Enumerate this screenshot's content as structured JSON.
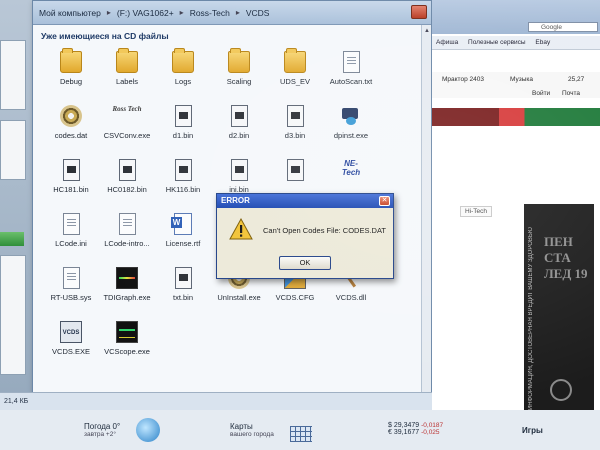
{
  "explorer": {
    "path": [
      "Мой компьютер",
      "(F:) VAG1062+",
      "Ross-Tech",
      "VCDS"
    ],
    "group_header": "Уже имеющиеся на CD файлы",
    "status_text": "21,4 КБ",
    "files": [
      {
        "label": "Debug",
        "icon": "folder-icon"
      },
      {
        "label": "Labels",
        "icon": "folder-icon"
      },
      {
        "label": "Logs",
        "icon": "folder-icon"
      },
      {
        "label": "Scaling",
        "icon": "folder-icon"
      },
      {
        "label": "UDS_EV",
        "icon": "folder-icon"
      },
      {
        "label": "AutoScan.txt",
        "icon": "text-file-icon"
      },
      {
        "label": "codes.dat",
        "icon": "cd-icon"
      },
      {
        "label": "CSVConv.exe",
        "icon": "rosstech-icon"
      },
      {
        "label": "d1.bin",
        "icon": "bin-file-icon"
      },
      {
        "label": "d2.bin",
        "icon": "bin-file-icon"
      },
      {
        "label": "d3.bin",
        "icon": "bin-file-icon"
      },
      {
        "label": "dpinst.exe",
        "icon": "installer-icon"
      },
      {
        "label": "HC181.bin",
        "icon": "bin-file-icon"
      },
      {
        "label": "HC0182.bin",
        "icon": "bin-file-icon"
      },
      {
        "label": "HK116.bin",
        "icon": "bin-file-icon"
      },
      {
        "label": "ini.bin",
        "icon": "bin-file-icon"
      },
      {
        "label": "",
        "icon": "bin-file-icon"
      },
      {
        "label": "",
        "icon": "nettech-icon"
      },
      {
        "label": "LCode.ini",
        "icon": "text-file-icon"
      },
      {
        "label": "LCode-intro...",
        "icon": "text-file-icon"
      },
      {
        "label": "License.rtf",
        "icon": "word-icon"
      },
      {
        "label": "RT-USB.sys",
        "icon": "text-file-icon"
      },
      {
        "label": "TDIGraph.exe",
        "icon": "chart-icon"
      },
      {
        "label": "txt.bin",
        "icon": "bin-file-icon"
      },
      {
        "label": "UnInstall.exe",
        "icon": "cd-icon"
      },
      {
        "label": "VCDS.CFG",
        "icon": "shield-icon"
      },
      {
        "label": "VCDS.dll",
        "icon": "hammer-icon"
      },
      {
        "label": "VCDS.EXE",
        "icon": "vcds-icon"
      },
      {
        "label": "VCScope.exe",
        "icon": "scope-icon"
      }
    ],
    "icon_texts": {
      "rosstech": "Ross Tech",
      "nettech": "NE-Tech",
      "vcds": "VCDS"
    }
  },
  "error_dialog": {
    "title": "ERROR",
    "message": "Can't Open Codes File: CODES.DAT",
    "ok_label": "OK"
  },
  "browser": {
    "search_placeholder": "Google",
    "bookmarks": [
      "Афиша",
      "Полезные сервисы",
      "Ebay"
    ],
    "nav_rows": [
      "Мрактор 2403",
      "Музыка",
      "25,27",
      "Войти",
      "Почта"
    ],
    "hitech": "Hi-Tech",
    "news_big": "ПЕН СТА ЛЕД 19",
    "news_vertical": "ИНФОРМАЦИЯ, ДОСТОВЕРНАЯ ВРЕДИТ ВАШЕМУ ЗДОРОВЬЮ"
  },
  "bottom": {
    "weather_title": "Погода 0°",
    "weather_sub": "завтра +2°",
    "maps_title": "Карты",
    "maps_sub": "вашего города",
    "usd": "$ 29,3479",
    "usd_delta": "-0,0187",
    "eur": "€ 39,1677",
    "eur_delta": "-0,025",
    "games": "Игры"
  },
  "colors": {
    "title_blue": "#1945b0",
    "window_bg": "#ece9d8",
    "accent_green": "#1f7a3a"
  }
}
